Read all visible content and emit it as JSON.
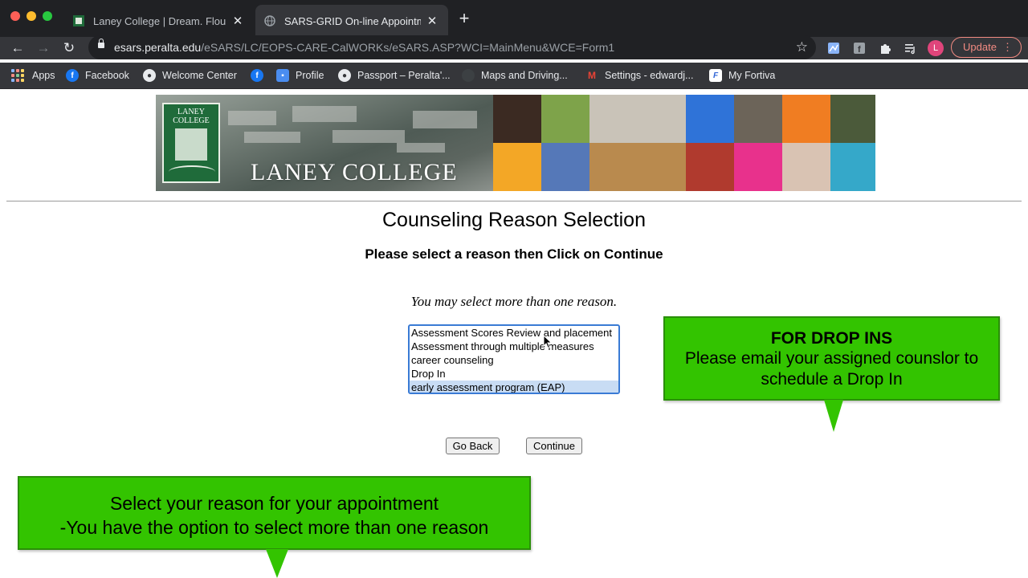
{
  "browser": {
    "tabs": [
      {
        "title": "Laney College | Dream. Flourish",
        "active": false
      },
      {
        "title": "SARS-GRID On-line Appointment",
        "active": true
      }
    ],
    "url_host": "esars.peralta.edu",
    "url_path": "/eSARS/LC/EOPS-CARE-CalWORKs/eSARS.ASP?WCI=MainMenu&WCE=Form1",
    "profile_initial": "L",
    "update_label": "Update",
    "bookmarks": [
      {
        "label": "Apps",
        "icon": "apps-grid-icon"
      },
      {
        "label": "Facebook",
        "icon": "facebook-icon"
      },
      {
        "label": "Welcome Center",
        "icon": "globe-icon"
      },
      {
        "label": "",
        "icon": "facebook-icon"
      },
      {
        "label": "Profile",
        "icon": "chat-icon"
      },
      {
        "label": "Passport – Peralta'...",
        "icon": "globe-icon"
      },
      {
        "label": "Maps and Driving...",
        "icon": "maps-icon"
      },
      {
        "label": "Settings - edwardj...",
        "icon": "gmail-icon"
      },
      {
        "label": "My Fortiva",
        "icon": "fortiva-icon"
      }
    ]
  },
  "banner": {
    "logo_text": "LANEY COLLEGE",
    "name": "LANEY COLLEGE"
  },
  "page": {
    "title": "Counseling Reason Selection",
    "instruction": "Please select a reason then Click on Continue",
    "note": "You may select more than one reason.",
    "reasons": [
      {
        "label": "Assessment Scores Review and placement",
        "selected": false
      },
      {
        "label": "Assessment through multiple measures",
        "selected": false
      },
      {
        "label": "career counseling",
        "selected": false
      },
      {
        "label": "Drop In",
        "selected": false
      },
      {
        "label": "early assessment program (EAP)",
        "selected": true
      }
    ],
    "go_back_label": "Go Back",
    "continue_label": "Continue"
  },
  "callouts": {
    "drop_ins": {
      "title": "FOR DROP INS",
      "body": "Please email your assigned counslor to schedule a Drop In"
    },
    "reason": {
      "line1": "Select your reason for your appointment",
      "line2": "-You have the option to select more than one reason"
    }
  },
  "colors": {
    "callout_green": "#33c400",
    "selected_option": "#c8dcf4",
    "listbox_focus": "#3a7bd5"
  }
}
